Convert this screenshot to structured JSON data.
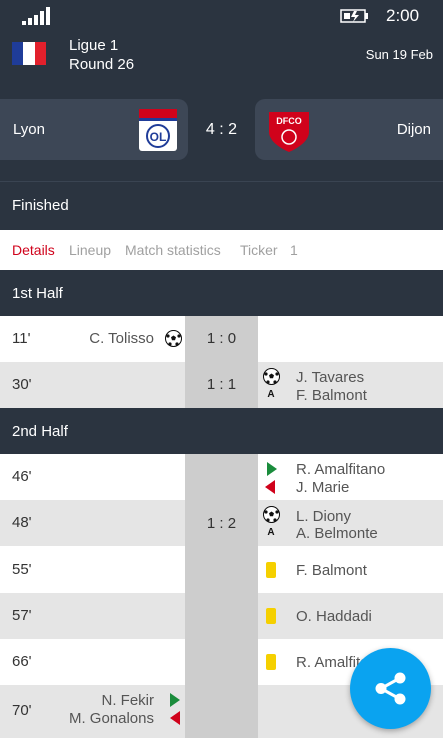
{
  "status_bar": {
    "time": "2:00"
  },
  "header": {
    "league": "Ligue 1",
    "round": "Round 26",
    "date": "Sun 19 Feb"
  },
  "match": {
    "home": {
      "name": "Lyon",
      "crest_text": "OL"
    },
    "away": {
      "name": "Dijon",
      "crest_text": "DFCO"
    },
    "score": "4 : 2",
    "status": "Finished"
  },
  "tabs": [
    {
      "label": "Details",
      "active": true
    },
    {
      "label": "Lineup",
      "active": false
    },
    {
      "label": "Match statistics",
      "active": false
    },
    {
      "label": "Ticker",
      "active": false
    },
    {
      "label": "1",
      "active": false
    }
  ],
  "sections": {
    "first_half": "1st Half",
    "second_half": "2nd Half"
  },
  "events": [
    {
      "minute": "11'",
      "score": "1 : 0",
      "side": "home",
      "type": "goal",
      "player": "C. Tolisso"
    },
    {
      "minute": "30'",
      "score": "1 : 1",
      "side": "away",
      "type": "goal",
      "player": "J. Tavares",
      "assist": "F. Balmont"
    },
    {
      "minute": "46'",
      "side": "away",
      "type": "substitution",
      "player_in": "R. Amalfitano",
      "player_out": "J. Marie"
    },
    {
      "minute": "48'",
      "score": "1 : 2",
      "side": "away",
      "type": "goal",
      "player": "L. Diony",
      "assist": "A. Belmonte"
    },
    {
      "minute": "55'",
      "side": "away",
      "type": "yellow-card",
      "player": "F. Balmont"
    },
    {
      "minute": "57'",
      "side": "away",
      "type": "yellow-card",
      "player": "O. Haddadi"
    },
    {
      "minute": "66'",
      "side": "away",
      "type": "yellow-card",
      "player": "R. Amalfitano"
    },
    {
      "minute": "70'",
      "side": "home",
      "type": "substitution",
      "player_in": "N. Fekir",
      "player_out": "M. Gonalons"
    }
  ],
  "colors": {
    "dark": "#2b3440",
    "accent_red": "#d0021b",
    "fab_blue": "#0aa3f0",
    "sub_in": "#1a8c3c",
    "yellow_card": "#f5d000"
  },
  "icons": {
    "goal": "soccer-ball-icon",
    "assist": "assist-icon",
    "sub_in": "arrow-in-icon",
    "sub_out": "arrow-out-icon",
    "card": "yellow-card-icon",
    "share": "share-icon"
  }
}
